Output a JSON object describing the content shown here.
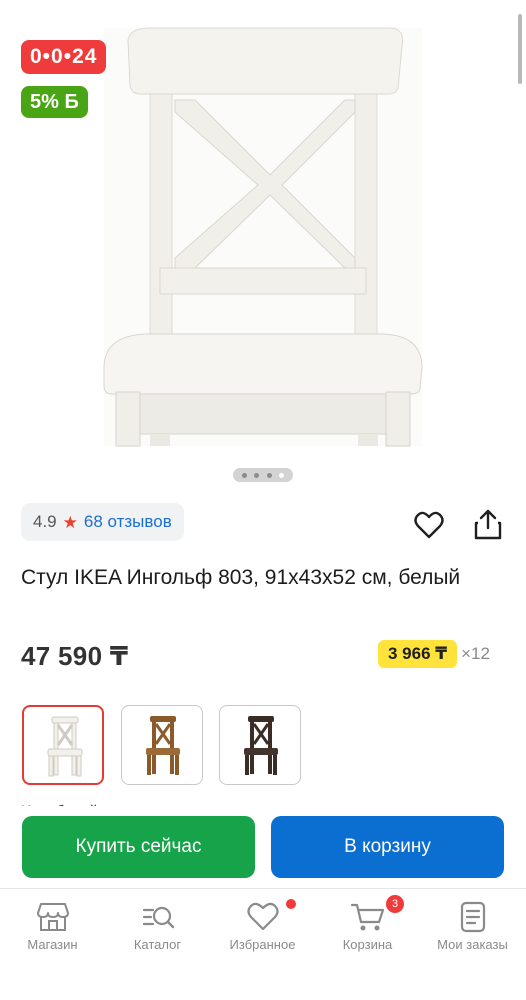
{
  "product": {
    "badges": {
      "timer": "0•0•24",
      "bonus": "5% Б"
    },
    "image_alt": "chair-photo",
    "carousel": {
      "count": 4,
      "active_index": 3
    },
    "rating": {
      "value": "4.9",
      "reviews_label": "68 отзывов"
    },
    "title": "Стул IKEA Ингольф 803, 91x43x52 см, белый",
    "price": "47 590 ₸",
    "installment": {
      "amount": "3 966 ₸",
      "months": "×12"
    },
    "variants": [
      {
        "name": "white",
        "color": "#f2f0ea",
        "selected": true
      },
      {
        "name": "brown",
        "color": "#8a5a2b",
        "selected": false
      },
      {
        "name": "black-brown",
        "color": "#3a2d26",
        "selected": false
      }
    ],
    "truncated_label": "Цвет белый"
  },
  "actions": {
    "buy_now": "Купить сейчас",
    "add_to_cart": "В корзину"
  },
  "bottom_nav": [
    {
      "label": "Магазин",
      "icon": "store-icon"
    },
    {
      "label": "Каталог",
      "icon": "catalog-search-icon"
    },
    {
      "label": "Избранное",
      "icon": "heart-icon",
      "dot": true
    },
    {
      "label": "Корзина",
      "icon": "cart-icon",
      "count": "3"
    },
    {
      "label": "Мои заказы",
      "icon": "orders-icon"
    }
  ],
  "colors": {
    "timer_badge": "#ef3b3b",
    "bonus_badge": "#4aa514",
    "buy_now": "#16a34a",
    "add_to_cart": "#0a6fd0",
    "installment_highlight": "#ffe33b",
    "link": "#1a6fd1",
    "selected_variant_border": "#e53b35"
  }
}
